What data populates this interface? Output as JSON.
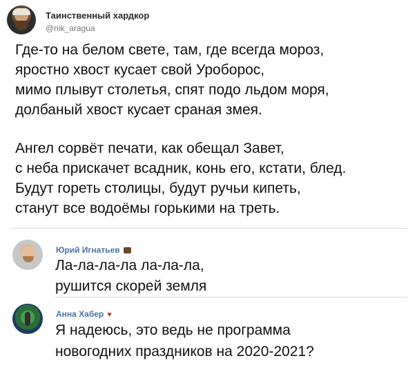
{
  "tweet": {
    "author_name": "Таинственный хардкор",
    "author_handle": "@nik_aragua",
    "stanzas": [
      [
        "Где-то на белом свете, там, где всегда мороз,",
        "яростно хвост кусает свой Уроборос,",
        "мимо плывут столетья, спят подо льдом моря,",
        "долбаный хвост кусает сраная змея."
      ],
      [
        "Ангел сорвёт печати, как обещал Завет,",
        "с неба прискачет всадник, конь его, кстати, блед.",
        "Будут гореть столицы, будут ручьи кипеть,",
        "станут все водоёмы горькими на треть."
      ]
    ]
  },
  "comments": [
    {
      "name": "Юрий Игнатьев",
      "badge": "briefcase-icon",
      "lines": [
        "Ла-ла-ла-ла ла-ла-ла,",
        "рушится скорей земля"
      ]
    },
    {
      "name": "Анна Хабер",
      "badge": "heart-arrow-icon",
      "lines": [
        "Я надеюсь, это ведь не программа",
        "новогодних праздников на 2020-2021?"
      ]
    }
  ],
  "colors": {
    "comment_name": "#4b73a8",
    "divider": "#d9d9d9"
  }
}
